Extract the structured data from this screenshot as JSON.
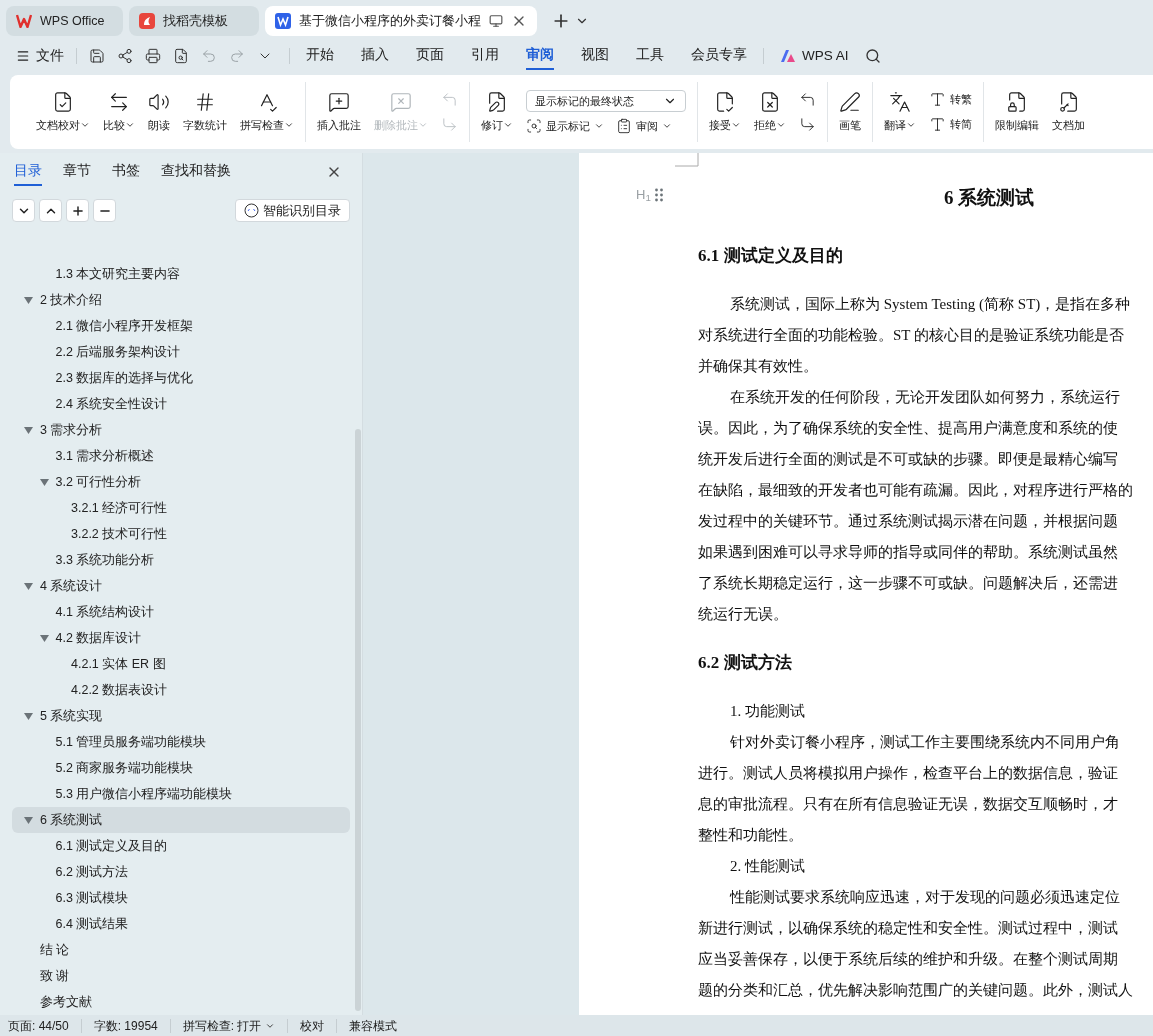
{
  "title_tabs": [
    {
      "label": "WPS Office",
      "selected": false
    },
    {
      "label": "找稻壳模板",
      "selected": false
    },
    {
      "label": "基于微信小程序的外卖订餐小程",
      "selected": true
    }
  ],
  "menu": {
    "file": "文件",
    "tabs": [
      {
        "label": "开始",
        "selected": false
      },
      {
        "label": "插入",
        "selected": false
      },
      {
        "label": "页面",
        "selected": false
      },
      {
        "label": "引用",
        "selected": false
      },
      {
        "label": "审阅",
        "selected": true
      },
      {
        "label": "视图",
        "selected": false
      },
      {
        "label": "工具",
        "selected": false
      },
      {
        "label": "会员专享",
        "selected": false
      }
    ],
    "ai": "WPS AI"
  },
  "ribbon": [
    {
      "items": [
        {
          "kind": "large",
          "label": "文档校对",
          "dropdown": true,
          "disabled": false
        },
        {
          "kind": "large",
          "label": "比较",
          "dropdown": true,
          "disabled": false
        },
        {
          "kind": "large",
          "label": "朗读",
          "dropdown": false,
          "disabled": false
        },
        {
          "kind": "large",
          "label": "字数统计",
          "dropdown": false,
          "disabled": false
        },
        {
          "kind": "large",
          "label": "拼写检查",
          "dropdown": true,
          "disabled": false
        }
      ]
    },
    {
      "items": [
        {
          "kind": "large",
          "label": "插入批注",
          "dropdown": false,
          "disabled": false
        },
        {
          "kind": "large",
          "label": "删除批注",
          "dropdown": true,
          "disabled": true
        },
        {
          "kind": "pair",
          "items": [
            {
              "disabled": true
            },
            {
              "disabled": true
            }
          ]
        }
      ]
    },
    {
      "items": [
        {
          "kind": "large",
          "label": "修订",
          "dropdown": true,
          "disabled": false
        },
        {
          "kind": "stack",
          "select": "显示标记的最终状态",
          "buttons": [
            {
              "label": "显示标记",
              "dropdown": true
            },
            {
              "label": "审阅",
              "dropdown": true
            }
          ]
        }
      ]
    },
    {
      "items": [
        {
          "kind": "large",
          "label": "接受",
          "dropdown": true,
          "disabled": false
        },
        {
          "kind": "large",
          "label": "拒绝",
          "dropdown": true,
          "disabled": false
        },
        {
          "kind": "pair",
          "items": [
            {
              "disabled": false
            },
            {
              "disabled": false
            }
          ]
        }
      ]
    },
    {
      "items": [
        {
          "kind": "large",
          "label": "画笔",
          "dropdown": false,
          "disabled": false
        }
      ]
    },
    {
      "items": [
        {
          "kind": "large",
          "label": "翻译",
          "dropdown": true,
          "disabled": false
        },
        {
          "kind": "pair",
          "items": [
            {
              "label": "转繁",
              "disabled": false
            },
            {
              "label": "转简",
              "disabled": false
            }
          ]
        }
      ]
    },
    {
      "items": [
        {
          "kind": "large",
          "label": "限制编辑",
          "dropdown": false,
          "disabled": false
        },
        {
          "kind": "large",
          "label": "文档加",
          "dropdown": false,
          "disabled": false
        }
      ]
    }
  ],
  "sidebar": {
    "tabs": [
      {
        "label": "目录",
        "selected": true
      },
      {
        "label": "章节",
        "selected": false
      },
      {
        "label": "书签",
        "selected": false
      },
      {
        "label": "查找和替换",
        "selected": false
      }
    ],
    "smart_button": "智能识别目录",
    "toc": [
      {
        "children": [
          {
            "text": "1.3  本文研究主要内容",
            "selected": false
          }
        ]
      },
      {
        "text": "2  技术介绍",
        "selected": false,
        "expanded": true,
        "children": [
          {
            "text": "2.1  微信小程序开发框架",
            "selected": false
          },
          {
            "text": "2.2  后端服务架构设计",
            "selected": false
          },
          {
            "text": "2.3  数据库的选择与优化",
            "selected": false
          },
          {
            "text": "2.4  系统安全性设计",
            "selected": false
          }
        ]
      },
      {
        "text": "3  需求分析",
        "selected": false,
        "expanded": true,
        "children": [
          {
            "text": "3.1  需求分析概述",
            "selected": false
          },
          {
            "text": "3.2  可行性分析",
            "selected": false,
            "expanded": true,
            "children": [
              {
                "text": "3.2.1  经济可行性",
                "selected": false
              },
              {
                "text": "3.2.2  技术可行性",
                "selected": false
              }
            ]
          },
          {
            "text": "3.3  系统功能分析",
            "selected": false
          }
        ]
      },
      {
        "text": "4  系统设计",
        "selected": false,
        "expanded": true,
        "children": [
          {
            "text": "4.1 系统结构设计",
            "selected": false
          },
          {
            "text": "4.2  数据库设计",
            "selected": false,
            "expanded": true,
            "children": [
              {
                "text": "4.2.1  实体 ER 图",
                "selected": false
              },
              {
                "text": "4.2.2  数据表设计",
                "selected": false
              }
            ]
          }
        ]
      },
      {
        "text": "5  系统实现",
        "selected": false,
        "expanded": true,
        "children": [
          {
            "text": "5.1  管理员服务端功能模块",
            "selected": false
          },
          {
            "text": "5.2  商家服务端功能模块",
            "selected": false
          },
          {
            "text": "5.3 用户微信小程序端功能模块",
            "selected": false
          }
        ]
      },
      {
        "text": "6  系统测试",
        "selected": true,
        "expanded": true,
        "children": [
          {
            "text": "6.1  测试定义及目的",
            "selected": false
          },
          {
            "text": "6.2  测试方法",
            "selected": false
          },
          {
            "text": "6.3  测试模块",
            "selected": false
          },
          {
            "text": "6.4  测试结果",
            "selected": false
          }
        ]
      },
      {
        "text": "结  论",
        "selected": false
      },
      {
        "text": "致  谢",
        "selected": false
      },
      {
        "text": "参考文献",
        "selected": false
      }
    ]
  },
  "document": {
    "heading_marker": "H$_{1}$",
    "blocks": [
      {
        "kind": "h1",
        "text": "6  系统测试"
      },
      {
        "kind": "h2",
        "text": "6.1  测试定义及目的"
      },
      {
        "kind": "para",
        "lines": [
          "系统测试，国际上称为 System Testing (简称 ST)，是指在多种",
          "对系统进行全面的功能检验。ST 的核心目的是验证系统功能是否",
          "并确保其有效性。"
        ]
      },
      {
        "kind": "para",
        "lines": [
          "在系统开发的任何阶段，无论开发团队如何努力，系统运行",
          "误。因此，为了确保系统的安全性、提高用户满意度和系统的使",
          "统开发后进行全面的测试是不可或缺的步骤。即便是最精心编写",
          "在缺陷，最细致的开发者也可能有疏漏。因此，对程序进行严格的",
          "发过程中的关键环节。通过系统测试揭示潜在问题，并根据问题",
          "如果遇到困难可以寻求导师的指导或同伴的帮助。系统测试虽然",
          "了系统长期稳定运行，这一步骤不可或缺。问题解决后，还需进",
          "统运行无误。"
        ]
      },
      {
        "kind": "h2",
        "text": "6.2  测试方法"
      },
      {
        "kind": "item",
        "text": "1.  功能测试"
      },
      {
        "kind": "para",
        "lines": [
          "针对外卖订餐小程序，测试工作主要围绕系统内不同用户角",
          "进行。测试人员将模拟用户操作，检查平台上的数据信息，验证",
          "息的审批流程。只有在所有信息验证无误，数据交互顺畅时，才",
          "整性和功能性。"
        ]
      },
      {
        "kind": "item",
        "text": "2.  性能测试"
      },
      {
        "kind": "para",
        "lines": [
          "性能测试要求系统响应迅速，对于发现的问题必须迅速定位",
          "新进行测试，以确保系统的稳定性和安全性。测试过程中，测试",
          "应当妥善保存，以便于系统后续的维护和升级。在整个测试周期",
          "题的分类和汇总，优先解决影响范围广的关键问题。此外，测试人"
        ]
      }
    ]
  },
  "status_bar": [
    {
      "text": "页面: 44/50",
      "dropdown": false
    },
    {
      "text": "字数: 19954",
      "dropdown": false
    },
    {
      "text": "拼写检查: 打开",
      "dropdown": true
    },
    {
      "text": "校对",
      "dropdown": false
    },
    {
      "text": "兼容模式",
      "dropdown": false
    }
  ]
}
